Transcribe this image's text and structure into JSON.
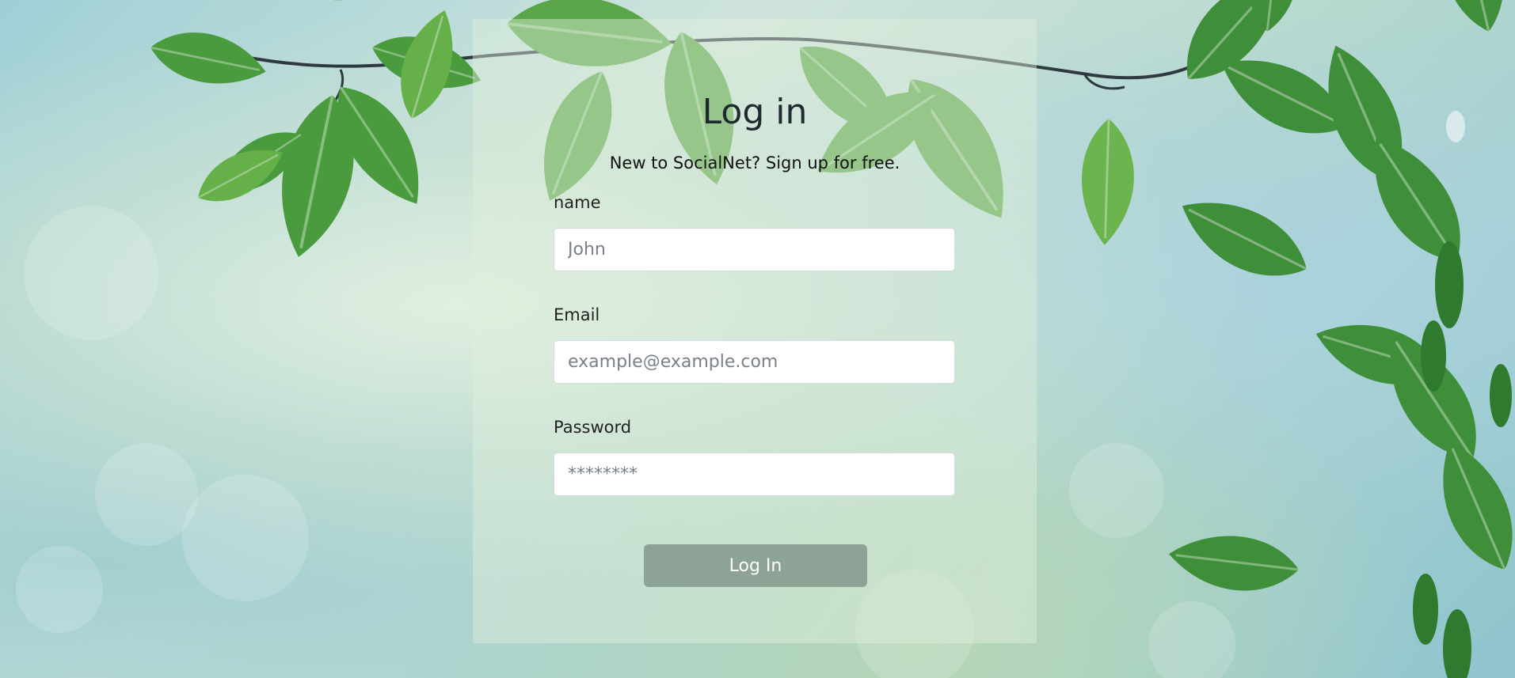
{
  "form": {
    "title": "Log in",
    "subtitle": "New to SocialNet? Sign up for free.",
    "name_label": "name",
    "name_placeholder": "John",
    "email_label": "Email",
    "email_placeholder": "example@example.com",
    "password_label": "Password",
    "password_placeholder": "********",
    "submit_label": "Log In"
  },
  "colors": {
    "button_bg": "#8da395",
    "leaf_green": "#3f8f3a",
    "card_tint": "#e1f0dc"
  }
}
